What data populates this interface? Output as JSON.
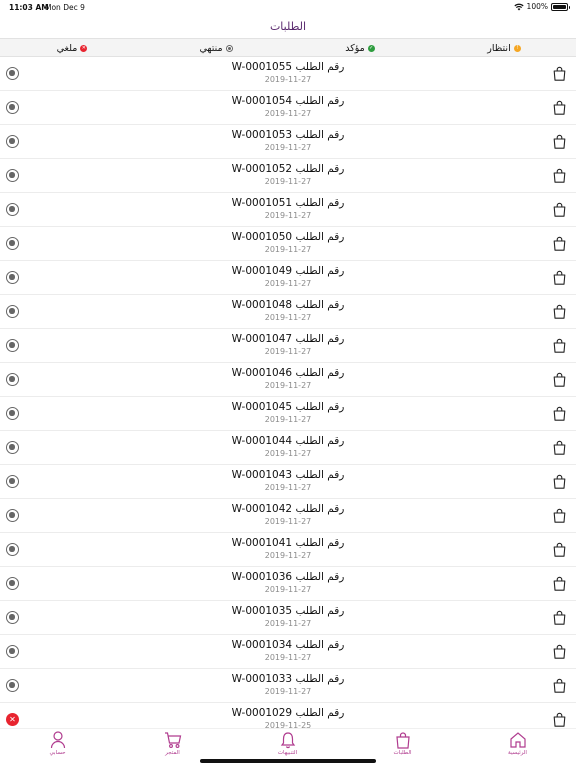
{
  "status_bar": {
    "time": "11:03 AM",
    "date": "Mon Dec 9",
    "battery": "100%"
  },
  "title": "الطلبات",
  "filters": [
    {
      "label": "انتظار",
      "icon": "pending-dot-icon"
    },
    {
      "label": "مؤكد",
      "icon": "confirmed-check-icon"
    },
    {
      "label": "منتهي",
      "icon": "done-dot-icon"
    },
    {
      "label": "ملغي",
      "icon": "canceled-x-icon"
    }
  ],
  "orders": [
    {
      "title": "رقم الطلب W-0001055",
      "date": "2019-11-27",
      "status": "radio"
    },
    {
      "title": "رقم الطلب W-0001054",
      "date": "2019-11-27",
      "status": "radio"
    },
    {
      "title": "رقم الطلب W-0001053",
      "date": "2019-11-27",
      "status": "radio"
    },
    {
      "title": "رقم الطلب W-0001052",
      "date": "2019-11-27",
      "status": "radio"
    },
    {
      "title": "رقم الطلب W-0001051",
      "date": "2019-11-27",
      "status": "radio"
    },
    {
      "title": "رقم الطلب W-0001050",
      "date": "2019-11-27",
      "status": "radio"
    },
    {
      "title": "رقم الطلب W-0001049",
      "date": "2019-11-27",
      "status": "radio"
    },
    {
      "title": "رقم الطلب W-0001048",
      "date": "2019-11-27",
      "status": "radio"
    },
    {
      "title": "رقم الطلب W-0001047",
      "date": "2019-11-27",
      "status": "radio"
    },
    {
      "title": "رقم الطلب W-0001046",
      "date": "2019-11-27",
      "status": "radio"
    },
    {
      "title": "رقم الطلب W-0001045",
      "date": "2019-11-27",
      "status": "radio"
    },
    {
      "title": "رقم الطلب W-0001044",
      "date": "2019-11-27",
      "status": "radio"
    },
    {
      "title": "رقم الطلب W-0001043",
      "date": "2019-11-27",
      "status": "radio"
    },
    {
      "title": "رقم الطلب W-0001042",
      "date": "2019-11-27",
      "status": "radio"
    },
    {
      "title": "رقم الطلب W-0001041",
      "date": "2019-11-27",
      "status": "radio"
    },
    {
      "title": "رقم الطلب W-0001036",
      "date": "2019-11-27",
      "status": "radio"
    },
    {
      "title": "رقم الطلب W-0001035",
      "date": "2019-11-27",
      "status": "radio"
    },
    {
      "title": "رقم الطلب W-0001034",
      "date": "2019-11-27",
      "status": "radio"
    },
    {
      "title": "رقم الطلب W-0001033",
      "date": "2019-11-27",
      "status": "radio"
    },
    {
      "title": "رقم الطلب W-0001029",
      "date": "2019-11-25",
      "status": "cancel"
    }
  ],
  "tabbar": [
    {
      "label": "حسابي",
      "icon": "profile-icon"
    },
    {
      "label": "المتجر",
      "icon": "cart-icon"
    },
    {
      "label": "التنبيهات",
      "icon": "bell-icon"
    },
    {
      "label": "الطلبات",
      "icon": "bag-icon"
    },
    {
      "label": "الرئيسية",
      "icon": "home-icon"
    }
  ],
  "colors": {
    "accent": "#b03c8f",
    "title": "#5a2a6e",
    "pending": "#f5a623",
    "confirmed": "#2e9d3f",
    "canceled": "#e8242f"
  }
}
